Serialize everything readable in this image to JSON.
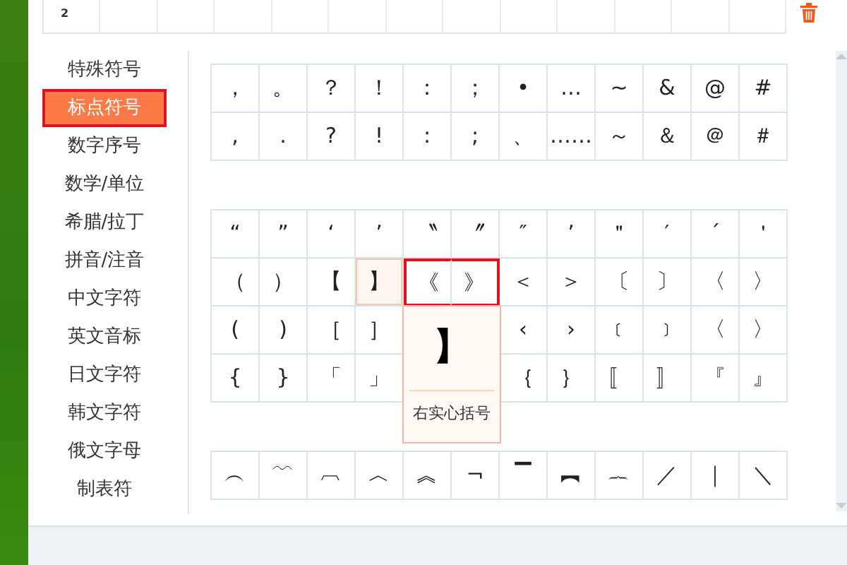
{
  "input_slots": [
    "2"
  ],
  "categories": [
    {
      "label": "特殊符号",
      "selected": false,
      "highlighted": false
    },
    {
      "label": "标点符号",
      "selected": true,
      "highlighted": true
    },
    {
      "label": "数字序号",
      "selected": false,
      "highlighted": false
    },
    {
      "label": "数学/单位",
      "selected": false,
      "highlighted": false
    },
    {
      "label": "希腊/拉丁",
      "selected": false,
      "highlighted": false
    },
    {
      "label": "拼音/注音",
      "selected": false,
      "highlighted": false
    },
    {
      "label": "中文字符",
      "selected": false,
      "highlighted": false
    },
    {
      "label": "英文音标",
      "selected": false,
      "highlighted": false
    },
    {
      "label": "日文字符",
      "selected": false,
      "highlighted": false
    },
    {
      "label": "韩文字符",
      "selected": false,
      "highlighted": false
    },
    {
      "label": "俄文字母",
      "selected": false,
      "highlighted": false
    },
    {
      "label": "制表符",
      "selected": false,
      "highlighted": false
    }
  ],
  "symbol_panels": [
    {
      "rows": [
        [
          {
            "symbol": "，",
            "hovered": false,
            "highlighted": false
          },
          {
            "symbol": "。",
            "hovered": false,
            "highlighted": false
          },
          {
            "symbol": "？",
            "hovered": false,
            "highlighted": false
          },
          {
            "symbol": "！",
            "hovered": false,
            "highlighted": false
          },
          {
            "symbol": "：",
            "hovered": false,
            "highlighted": false
          },
          {
            "symbol": "；",
            "hovered": false,
            "highlighted": false
          },
          {
            "symbol": "•",
            "hovered": false,
            "highlighted": false
          },
          {
            "symbol": "…",
            "hovered": false,
            "highlighted": false
          },
          {
            "symbol": "~",
            "hovered": false,
            "highlighted": false
          },
          {
            "symbol": "&",
            "hovered": false,
            "highlighted": false
          },
          {
            "symbol": "@",
            "hovered": false,
            "highlighted": false
          },
          {
            "symbol": "#",
            "hovered": false,
            "highlighted": false
          }
        ],
        [
          {
            "symbol": ",",
            "hovered": false,
            "highlighted": false
          },
          {
            "symbol": ".",
            "hovered": false,
            "highlighted": false
          },
          {
            "symbol": "?",
            "hovered": false,
            "highlighted": false
          },
          {
            "symbol": "!",
            "hovered": false,
            "highlighted": false
          },
          {
            "symbol": ":",
            "hovered": false,
            "highlighted": false
          },
          {
            "symbol": ";",
            "hovered": false,
            "highlighted": false
          },
          {
            "symbol": "、",
            "hovered": false,
            "highlighted": false
          },
          {
            "symbol": "……",
            "hovered": false,
            "highlighted": false
          },
          {
            "symbol": "～",
            "hovered": false,
            "highlighted": false
          },
          {
            "symbol": "＆",
            "hovered": false,
            "highlighted": false
          },
          {
            "symbol": "＠",
            "hovered": false,
            "highlighted": false
          },
          {
            "symbol": "＃",
            "hovered": false,
            "highlighted": false
          }
        ]
      ]
    },
    {
      "rows": [
        [
          {
            "symbol": "“",
            "hovered": false,
            "highlighted": false
          },
          {
            "symbol": "”",
            "hovered": false,
            "highlighted": false
          },
          {
            "symbol": "‘",
            "hovered": false,
            "highlighted": false
          },
          {
            "symbol": "’",
            "hovered": false,
            "highlighted": false
          },
          {
            "symbol": "〝",
            "hovered": false,
            "highlighted": false
          },
          {
            "symbol": "〞",
            "hovered": false,
            "highlighted": false
          },
          {
            "symbol": "″",
            "hovered": false,
            "highlighted": false
          },
          {
            "symbol": "’",
            "hovered": false,
            "highlighted": false
          },
          {
            "symbol": "＂",
            "hovered": false,
            "highlighted": false
          },
          {
            "symbol": "′",
            "hovered": false,
            "highlighted": false
          },
          {
            "symbol": "´",
            "hovered": false,
            "highlighted": false
          },
          {
            "symbol": "＇",
            "hovered": false,
            "highlighted": false
          }
        ],
        [
          {
            "symbol": "（",
            "hovered": false,
            "highlighted": false
          },
          {
            "symbol": "）",
            "hovered": false,
            "highlighted": false
          },
          {
            "symbol": "【",
            "hovered": false,
            "highlighted": false
          },
          {
            "symbol": "】",
            "hovered": true,
            "highlighted": false
          },
          {
            "symbol": "《",
            "hovered": false,
            "highlighted": true
          },
          {
            "symbol": "》",
            "hovered": false,
            "highlighted": true
          },
          {
            "symbol": "＜",
            "hovered": false,
            "highlighted": false
          },
          {
            "symbol": "＞",
            "hovered": false,
            "highlighted": false
          },
          {
            "symbol": "〔",
            "hovered": false,
            "highlighted": false
          },
          {
            "symbol": "〕",
            "hovered": false,
            "highlighted": false
          },
          {
            "symbol": "〈",
            "hovered": false,
            "highlighted": false
          },
          {
            "symbol": "〉",
            "hovered": false,
            "highlighted": false
          }
        ],
        [
          {
            "symbol": "(",
            "hovered": false,
            "highlighted": false
          },
          {
            "symbol": ")",
            "hovered": false,
            "highlighted": false
          },
          {
            "symbol": "［",
            "hovered": false,
            "highlighted": false
          },
          {
            "symbol": "］",
            "hovered": false,
            "highlighted": false
          },
          null,
          null,
          {
            "symbol": "‹",
            "hovered": false,
            "highlighted": false
          },
          {
            "symbol": "›",
            "hovered": false,
            "highlighted": false
          },
          {
            "symbol": "﹝",
            "hovered": false,
            "highlighted": false
          },
          {
            "symbol": "﹞",
            "hovered": false,
            "highlighted": false
          },
          {
            "symbol": "〈",
            "hovered": false,
            "highlighted": false
          },
          {
            "symbol": "〉",
            "hovered": false,
            "highlighted": false
          }
        ],
        [
          {
            "symbol": "{",
            "hovered": false,
            "highlighted": false
          },
          {
            "symbol": "}",
            "hovered": false,
            "highlighted": false
          },
          {
            "symbol": "「",
            "hovered": false,
            "highlighted": false
          },
          {
            "symbol": "」",
            "hovered": false,
            "highlighted": false
          },
          null,
          null,
          {
            "symbol": "｛",
            "hovered": false,
            "highlighted": false
          },
          {
            "symbol": "｝",
            "hovered": false,
            "highlighted": false
          },
          {
            "symbol": "〚",
            "hovered": false,
            "highlighted": false
          },
          {
            "symbol": "〛",
            "hovered": false,
            "highlighted": false
          },
          {
            "symbol": "『",
            "hovered": false,
            "highlighted": false
          },
          {
            "symbol": "』",
            "hovered": false,
            "highlighted": false
          }
        ]
      ]
    },
    {
      "rows": [
        [
          {
            "symbol": "︵",
            "hovered": false,
            "highlighted": false
          },
          {
            "symbol": "﹋",
            "hovered": false,
            "highlighted": false
          },
          {
            "symbol": "︹",
            "hovered": false,
            "highlighted": false
          },
          {
            "symbol": "︿",
            "hovered": false,
            "highlighted": false
          },
          {
            "symbol": "︽",
            "hovered": false,
            "highlighted": false
          },
          {
            "symbol": "¬",
            "hovered": false,
            "highlighted": false
          },
          {
            "symbol": "▔",
            "hovered": false,
            "highlighted": false
          },
          {
            "symbol": "︻",
            "hovered": false,
            "highlighted": false
          },
          {
            "symbol": "︷",
            "hovered": false,
            "highlighted": false
          },
          {
            "symbol": "／",
            "hovered": false,
            "highlighted": false
          },
          {
            "symbol": "｜",
            "hovered": false,
            "highlighted": false
          },
          {
            "symbol": "＼",
            "hovered": false,
            "highlighted": false
          }
        ]
      ]
    }
  ],
  "tooltip": {
    "symbol": "】",
    "name": "右实心括号"
  }
}
